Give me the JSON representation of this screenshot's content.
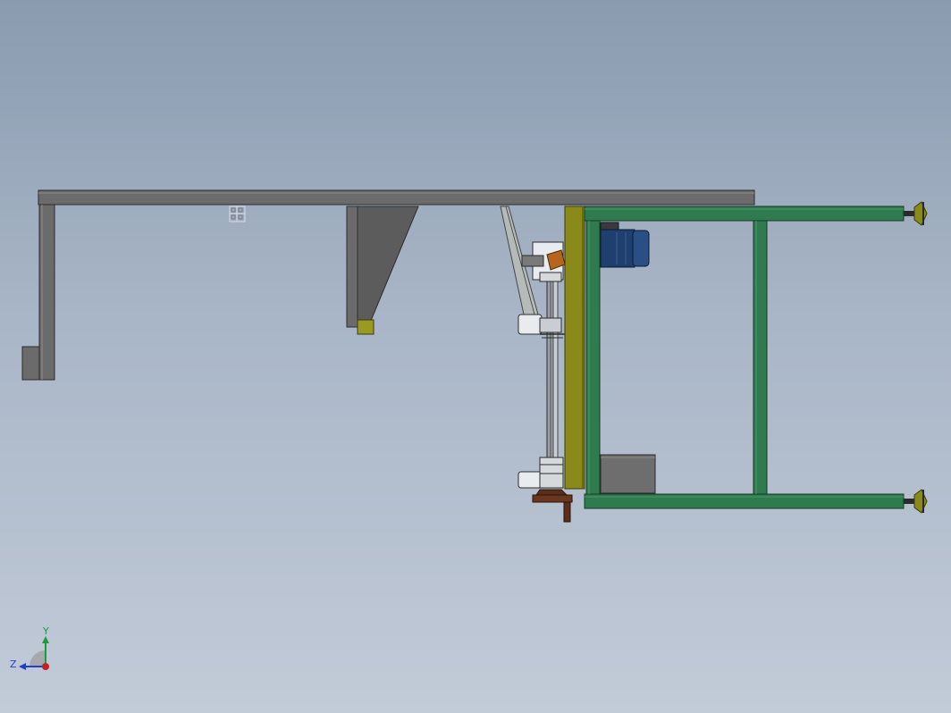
{
  "viewport": {
    "background_top": "#8a9bb0",
    "background_bottom": "#c2cbd8"
  },
  "colors": {
    "gray_steel": "#6b6b6b",
    "gray_steel_dark": "#4a4a4a",
    "green_frame": "#2f7a4f",
    "green_frame_dark": "#1f5535",
    "olive_plate": "#8a8a1a",
    "motor_blue": "#1f3f6e",
    "brown_part": "#5a2e1a",
    "orange_part": "#b5651d",
    "axis_x_red": "#c8201e",
    "axis_y_green": "#1e9a3a",
    "axis_z_blue": "#2040c8"
  },
  "triad": {
    "y_label": "Y",
    "z_label": "Z"
  },
  "parts": {
    "overhead_beam": "overhead-beam",
    "left_column": "left-column",
    "left_foot_block": "left-foot-block",
    "mid_bracket": "mid-bracket",
    "gusset": "gusset-plate",
    "green_frame": "green-frame",
    "motor": "motor",
    "gearbox": "gearbox-box",
    "leveling_feet": "leveling-feet"
  }
}
